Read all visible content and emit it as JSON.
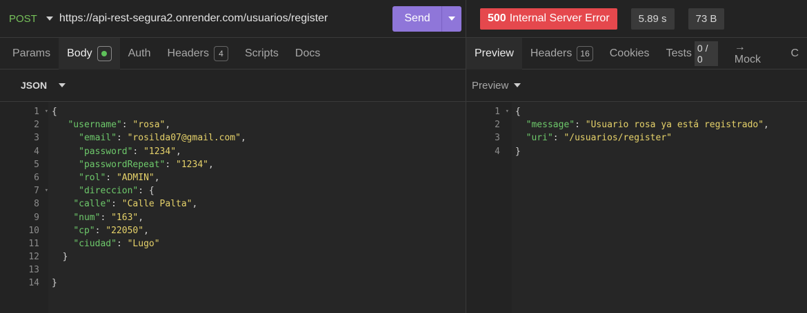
{
  "request": {
    "method": "POST",
    "url": "https://api-rest-segura2.onrender.com/usuarios/register",
    "send_label": "Send"
  },
  "response_status": {
    "code": "500",
    "text": "Internal Server Error",
    "time": "5.89 s",
    "size": "73 B",
    "status_color": "#e5484d"
  },
  "request_tabs": [
    {
      "label": "Params"
    },
    {
      "label": "Body",
      "indicator": "green-dot-icon"
    },
    {
      "label": "Auth"
    },
    {
      "label": "Headers",
      "count": "4"
    },
    {
      "label": "Scripts"
    },
    {
      "label": "Docs"
    }
  ],
  "response_tabs": [
    {
      "label": "Preview"
    },
    {
      "label": "Headers",
      "count": "16"
    },
    {
      "label": "Cookies"
    },
    {
      "label": "Tests",
      "badge": "0 / 0"
    },
    {
      "label": "→ Mock"
    },
    {
      "label": "C"
    }
  ],
  "body_format": "JSON",
  "preview_mode": "Preview",
  "request_body_lines": [
    "{",
    "   \"username\": \"rosa\",",
    "     \"email\": \"rosilda07@gmail.com\",",
    "     \"password\": \"1234\",",
    "     \"passwordRepeat\": \"1234\",",
    "     \"rol\": \"ADMIN\",",
    "     \"direccion\": {",
    "    \"calle\": \"Calle Palta\",",
    "    \"num\": \"163\",",
    "    \"cp\": \"22050\",",
    "    \"ciudad\": \"Lugo\"",
    "  }",
    "",
    "}"
  ],
  "response_body_lines": [
    "{",
    "  \"message\": \"Usuario rosa ya está registrado\",",
    "  \"uri\": \"/usuarios/register\"",
    "}"
  ],
  "request_fold_lines": [
    1,
    7
  ],
  "response_fold_lines": [
    1
  ],
  "colors": {
    "accent": "#8f76d9",
    "key": "#6ec96b",
    "string": "#e6d26a"
  }
}
